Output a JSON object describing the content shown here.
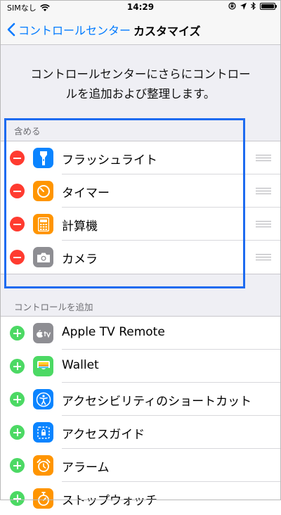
{
  "status_bar": {
    "carrier": "SIMなし",
    "time": "14:29"
  },
  "nav": {
    "back_label": "コントロールセンター",
    "title": "カスタマイズ"
  },
  "description_line1": "コントロールセンターにさらにコントロー",
  "description_line2": "ルを追加および整理します。",
  "included": {
    "header": "含める",
    "items": [
      {
        "label": "フラッシュライト",
        "icon": "flashlight-icon",
        "color": "#0a84ff"
      },
      {
        "label": "タイマー",
        "icon": "timer-icon",
        "color": "#ff9500"
      },
      {
        "label": "計算機",
        "icon": "calculator-icon",
        "color": "#ff9500"
      },
      {
        "label": "カメラ",
        "icon": "camera-icon",
        "color": "#8e8e93"
      }
    ]
  },
  "more": {
    "header": "コントロールを追加",
    "items": [
      {
        "label": "Apple TV Remote",
        "icon": "apple-tv-icon",
        "color": "#8e8e93"
      },
      {
        "label": "Wallet",
        "icon": "wallet-icon",
        "color": "#4cd964"
      },
      {
        "label": "アクセシビリティのショートカット",
        "icon": "accessibility-icon",
        "color": "#0a84ff"
      },
      {
        "label": "アクセスガイド",
        "icon": "guided-access-icon",
        "color": "#0a84ff"
      },
      {
        "label": "アラーム",
        "icon": "alarm-icon",
        "color": "#ff9500"
      },
      {
        "label": "ストップウォッチ",
        "icon": "stopwatch-icon",
        "color": "#ff9500"
      }
    ]
  },
  "colors": {
    "accent": "#007aff",
    "highlight_border": "#1e6bf0",
    "remove": "#ff3b30",
    "add": "#4cd964"
  }
}
